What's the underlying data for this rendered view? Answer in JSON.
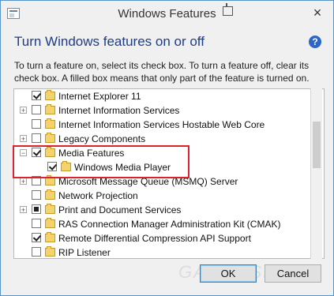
{
  "window": {
    "title": "Windows Features",
    "close_glyph": "×"
  },
  "header": {
    "heading": "Turn Windows features on or off",
    "help_glyph": "?",
    "description": "To turn a feature on, select its check box. To turn a feature off, clear its check box. A filled box means that only part of the feature is turned on."
  },
  "features": [
    {
      "label": "Internet Explorer 11",
      "state": "checked",
      "expander": null
    },
    {
      "label": "Internet Information Services",
      "state": "unchecked",
      "expander": "+"
    },
    {
      "label": "Internet Information Services Hostable Web Core",
      "state": "unchecked",
      "expander": null
    },
    {
      "label": "Legacy Components",
      "state": "unchecked",
      "expander": "+"
    },
    {
      "label": "Media Features",
      "state": "checked",
      "expander": "−"
    },
    {
      "label": "Windows Media Player",
      "state": "checked",
      "expander": null
    },
    {
      "label": "Microsoft Message Queue (MSMQ) Server",
      "state": "unchecked",
      "expander": "+"
    },
    {
      "label": "Network Projection",
      "state": "unchecked",
      "expander": null
    },
    {
      "label": "Print and Document Services",
      "state": "partial",
      "expander": "+"
    },
    {
      "label": "RAS Connection Manager Administration Kit (CMAK)",
      "state": "unchecked",
      "expander": null
    },
    {
      "label": "Remote Differential Compression API Support",
      "state": "checked",
      "expander": null
    },
    {
      "label": "RIP Listener",
      "state": "unchecked",
      "expander": null
    }
  ],
  "buttons": {
    "ok": "OK",
    "cancel": "Cancel"
  },
  "watermark": "GAMERSKY",
  "colors": {
    "heading": "#1f3d86",
    "highlight": "#d9232e",
    "folder": "#f4d36c"
  }
}
